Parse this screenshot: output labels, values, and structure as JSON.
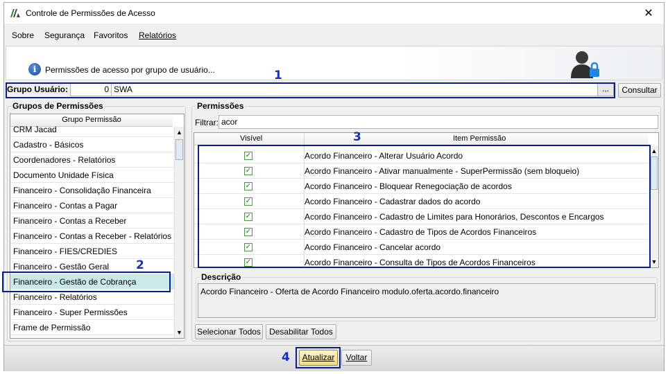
{
  "window": {
    "title": "Controle de Permissões de Acesso",
    "close_glyph": "✕"
  },
  "menu": {
    "items": [
      "Sobre",
      "Segurança",
      "Favoritos",
      "Relatórios"
    ]
  },
  "header": {
    "info_text": "Permissões de acesso por grupo de usuário...",
    "info_icon": "info-icon",
    "user_icon": "user-lock-icon"
  },
  "annotations": [
    "1",
    "2",
    "3",
    "4"
  ],
  "grupo_usuario": {
    "label": "Grupo Usuário:",
    "id": "0",
    "name": "SWA",
    "browse_label": "...",
    "consultar_label": "Consultar"
  },
  "grupos": {
    "title": "Grupos de Permissões",
    "column": "Grupo Permissão",
    "items": [
      "CRM Jacad",
      "Cadastro - Básicos",
      "Coordenadores - Relatórios",
      "Documento Unidade Física",
      "Financeiro - Consolidação Financeira",
      "Financeiro - Contas a Pagar",
      "Financeiro - Contas a Receber",
      "Financeiro - Contas a Receber - Relatórios",
      "Financeiro - FIES/CREDIES",
      "Financeiro - Gestão Geral",
      "Financeiro - Gestão de Cobrança",
      "Financeiro - Relatórios",
      "Financeiro - Super Permissões",
      "Frame de Permissão"
    ],
    "selected_index": 10
  },
  "permissoes": {
    "title": "Permissões",
    "filter_label": "Filtrar:",
    "filter_value": "acor",
    "col_visivel": "Visível",
    "col_item": "Item Permissão",
    "rows": [
      {
        "checked": true,
        "item": "Acordo Financeiro - Alterar Usuário Acordo"
      },
      {
        "checked": true,
        "item": "Acordo Financeiro - Ativar manualmente - SuperPermissão (sem bloqueio)"
      },
      {
        "checked": true,
        "item": "Acordo Financeiro - Bloquear Renegociação de acordos"
      },
      {
        "checked": true,
        "item": "Acordo Financeiro - Cadastrar dados do acordo"
      },
      {
        "checked": true,
        "item": "Acordo Financeiro - Cadastro de Limites para Honorários, Descontos e Encargos"
      },
      {
        "checked": true,
        "item": "Acordo Financeiro - Cadastro de Tipos de Acordos Financeiros"
      },
      {
        "checked": true,
        "item": "Acordo Financeiro - Cancelar acordo"
      },
      {
        "checked": true,
        "item": "Acordo Financeiro - Consulta de Tipos de Acordos Financeiros"
      }
    ]
  },
  "descricao": {
    "title": "Descrição",
    "text": "Acordo Financeiro - Oferta de Acordo Financeiro modulo.oferta.acordo.financeiro"
  },
  "actions": {
    "select_all": "Selecionar Todos",
    "disable_all": "Desabilitar Todos",
    "update": "Atualizar",
    "back": "Voltar"
  },
  "colors": {
    "annotation_blue": "#0a1e8c",
    "selected_row": "#cbe8ea",
    "check_green": "#1d7a1d"
  }
}
